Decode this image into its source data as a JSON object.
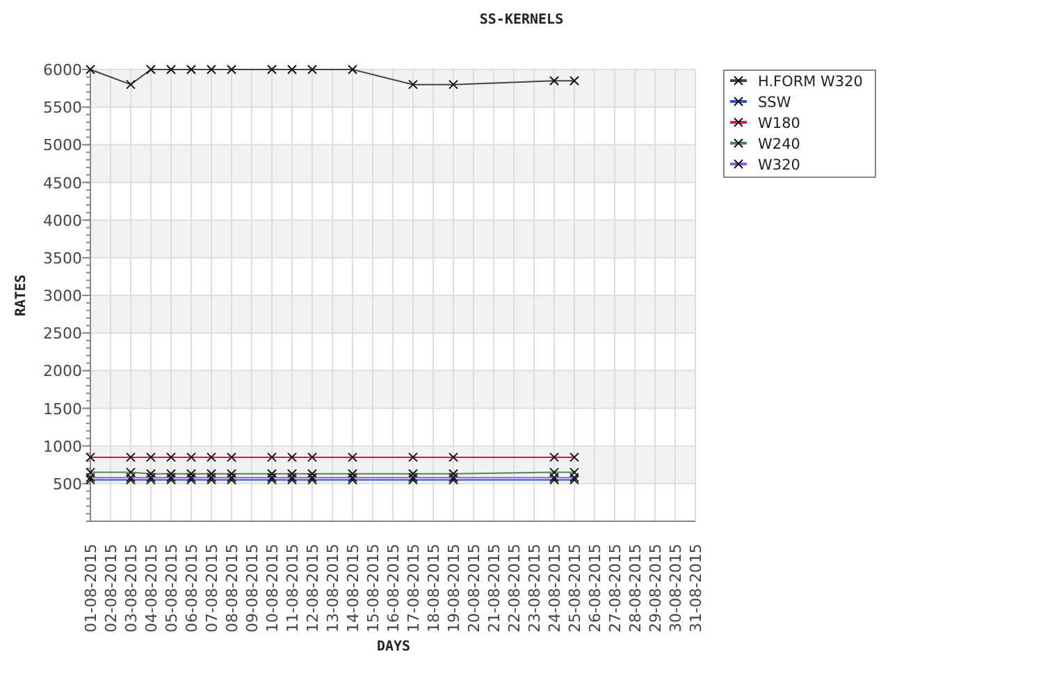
{
  "chart": {
    "chart_data": {
      "type": "line",
      "title": "SS-KERNELS",
      "xlabel": "DAYS",
      "ylabel": "RATES",
      "grid": true,
      "legend": true,
      "categories": [
        "01-08-2015",
        "02-08-2015",
        "03-08-2015",
        "04-08-2015",
        "05-08-2015",
        "06-08-2015",
        "07-08-2015",
        "08-08-2015",
        "09-08-2015",
        "10-08-2015",
        "11-08-2015",
        "12-08-2015",
        "13-08-2015",
        "14-08-2015",
        "15-08-2015",
        "16-08-2015",
        "17-08-2015",
        "18-08-2015",
        "19-08-2015",
        "20-08-2015",
        "21-08-2015",
        "22-08-2015",
        "23-08-2015",
        "24-08-2015",
        "25-08-2015",
        "26-08-2015",
        "27-08-2015",
        "28-08-2015",
        "29-08-2015",
        "30-08-2015",
        "31-08-2015"
      ],
      "ylim": [
        0,
        6000
      ],
      "yticks": [
        500,
        1000,
        1500,
        2000,
        2500,
        3000,
        3500,
        4000,
        4500,
        5000,
        5500,
        6000
      ],
      "series": [
        {
          "name": "H.FORM W320",
          "color": "#4d4040",
          "marker": "x",
          "values": [
            6000,
            null,
            5800,
            6000,
            6000,
            6000,
            6000,
            6000,
            null,
            6000,
            6000,
            6000,
            null,
            6000,
            null,
            null,
            5800,
            null,
            5800,
            null,
            null,
            null,
            null,
            5850,
            5850,
            null,
            null,
            null,
            null,
            null,
            null
          ]
        },
        {
          "name": "SSW",
          "color": "#3050d0",
          "marker": "x",
          "values": [
            550,
            null,
            550,
            550,
            550,
            550,
            550,
            550,
            null,
            550,
            550,
            550,
            null,
            550,
            null,
            null,
            550,
            null,
            550,
            null,
            null,
            null,
            null,
            550,
            550,
            null,
            null,
            null,
            null,
            null,
            null
          ]
        },
        {
          "name": "W180",
          "color": "#e0105a",
          "marker": "x",
          "values": [
            850,
            null,
            850,
            850,
            850,
            850,
            850,
            850,
            null,
            850,
            850,
            850,
            null,
            850,
            null,
            null,
            850,
            null,
            850,
            null,
            null,
            null,
            null,
            850,
            850,
            null,
            null,
            null,
            null,
            null,
            null
          ]
        },
        {
          "name": "W240",
          "color": "#4a8a4a",
          "marker": "x",
          "values": [
            650,
            null,
            650,
            630,
            630,
            630,
            630,
            630,
            null,
            630,
            630,
            630,
            null,
            630,
            null,
            null,
            630,
            null,
            630,
            null,
            null,
            null,
            null,
            650,
            650,
            null,
            null,
            null,
            null,
            null,
            null
          ]
        },
        {
          "name": "W320",
          "color": "#9060e0",
          "marker": "x",
          "values": [
            580,
            null,
            580,
            580,
            580,
            580,
            580,
            580,
            null,
            580,
            580,
            580,
            null,
            580,
            null,
            null,
            580,
            null,
            580,
            null,
            null,
            null,
            null,
            580,
            580,
            null,
            null,
            null,
            null,
            null,
            null
          ]
        }
      ]
    }
  }
}
